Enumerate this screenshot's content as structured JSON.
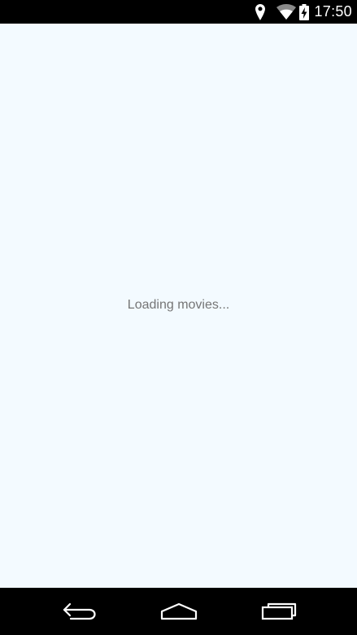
{
  "status_bar": {
    "time": "17:50",
    "icons": [
      "location-icon",
      "wifi-icon",
      "battery-charging-icon"
    ]
  },
  "main": {
    "loading_text": "Loading movies..."
  },
  "nav_bar": {
    "buttons": [
      "back-icon",
      "home-icon",
      "recents-icon"
    ]
  },
  "colors": {
    "background": "#f3faff",
    "bars": "#000000",
    "loading_text": "#757575"
  }
}
